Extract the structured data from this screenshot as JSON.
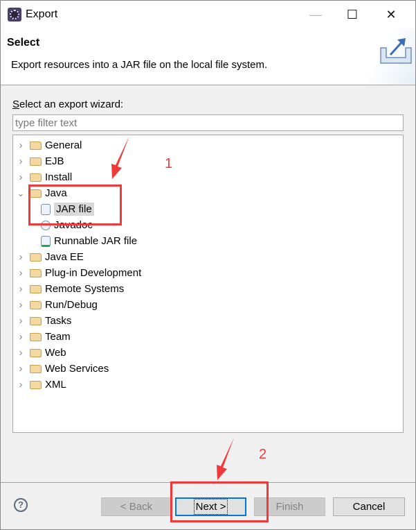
{
  "window": {
    "title": "Export",
    "controls": [
      "minimize",
      "maximize",
      "close"
    ]
  },
  "header": {
    "title": "Select",
    "description": "Export resources into a JAR file on the local file system.",
    "icon": "export-icon"
  },
  "filter": {
    "label_prefix": "S",
    "label_rest": "elect an export wizard:",
    "placeholder": "type filter text",
    "value": ""
  },
  "tree": {
    "items": [
      {
        "label": "General",
        "type": "folder",
        "expanded": false,
        "level": 0
      },
      {
        "label": "EJB",
        "type": "folder",
        "expanded": false,
        "level": 0
      },
      {
        "label": "Install",
        "type": "folder",
        "expanded": false,
        "level": 0
      },
      {
        "label": "Java",
        "type": "folder",
        "expanded": true,
        "level": 0
      },
      {
        "label": "JAR file",
        "type": "jar",
        "level": 1,
        "selected": true
      },
      {
        "label": "Javadoc",
        "type": "javadoc",
        "level": 1
      },
      {
        "label": "Runnable JAR file",
        "type": "runnable-jar",
        "level": 1
      },
      {
        "label": "Java EE",
        "type": "folder",
        "expanded": false,
        "level": 0
      },
      {
        "label": "Plug-in Development",
        "type": "folder",
        "expanded": false,
        "level": 0
      },
      {
        "label": "Remote Systems",
        "type": "folder",
        "expanded": false,
        "level": 0
      },
      {
        "label": "Run/Debug",
        "type": "folder",
        "expanded": false,
        "level": 0
      },
      {
        "label": "Tasks",
        "type": "folder",
        "expanded": false,
        "level": 0
      },
      {
        "label": "Team",
        "type": "folder",
        "expanded": false,
        "level": 0
      },
      {
        "label": "Web",
        "type": "folder",
        "expanded": false,
        "level": 0
      },
      {
        "label": "Web Services",
        "type": "folder",
        "expanded": false,
        "level": 0
      },
      {
        "label": "XML",
        "type": "folder",
        "expanded": false,
        "level": 0
      }
    ]
  },
  "buttons": {
    "help": "?",
    "back": "< Back",
    "next": "Next >",
    "finish": "Finish",
    "cancel": "Cancel"
  },
  "annotations": {
    "step1": "1",
    "step2": "2",
    "color": "#f03a3a"
  }
}
